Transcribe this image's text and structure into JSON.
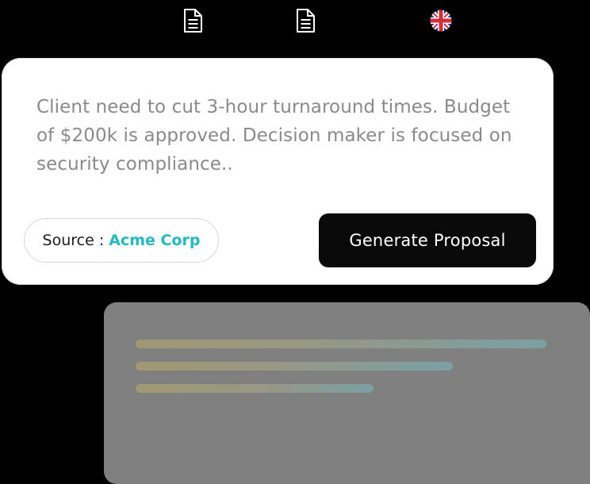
{
  "toolbar": {
    "icons": [
      {
        "name": "document-icon",
        "color": "#ffffff"
      },
      {
        "name": "document-icon",
        "color": "#ffffff"
      },
      {
        "name": "uk-flag-icon"
      }
    ]
  },
  "card": {
    "message": "Client need to cut 3-hour turnaround times. Budget of $200k is approved. Decision maker is focused on security compliance..",
    "source_label": "Source :",
    "source_value": "Acme Corp",
    "generate_label": "Generate Proposal"
  },
  "colors": {
    "background": "#000000",
    "card": "#ffffff",
    "message_text": "#8a8a8a",
    "accent": "#22b8c4",
    "button": "#0a0a0a",
    "preview_panel": "#808080"
  }
}
